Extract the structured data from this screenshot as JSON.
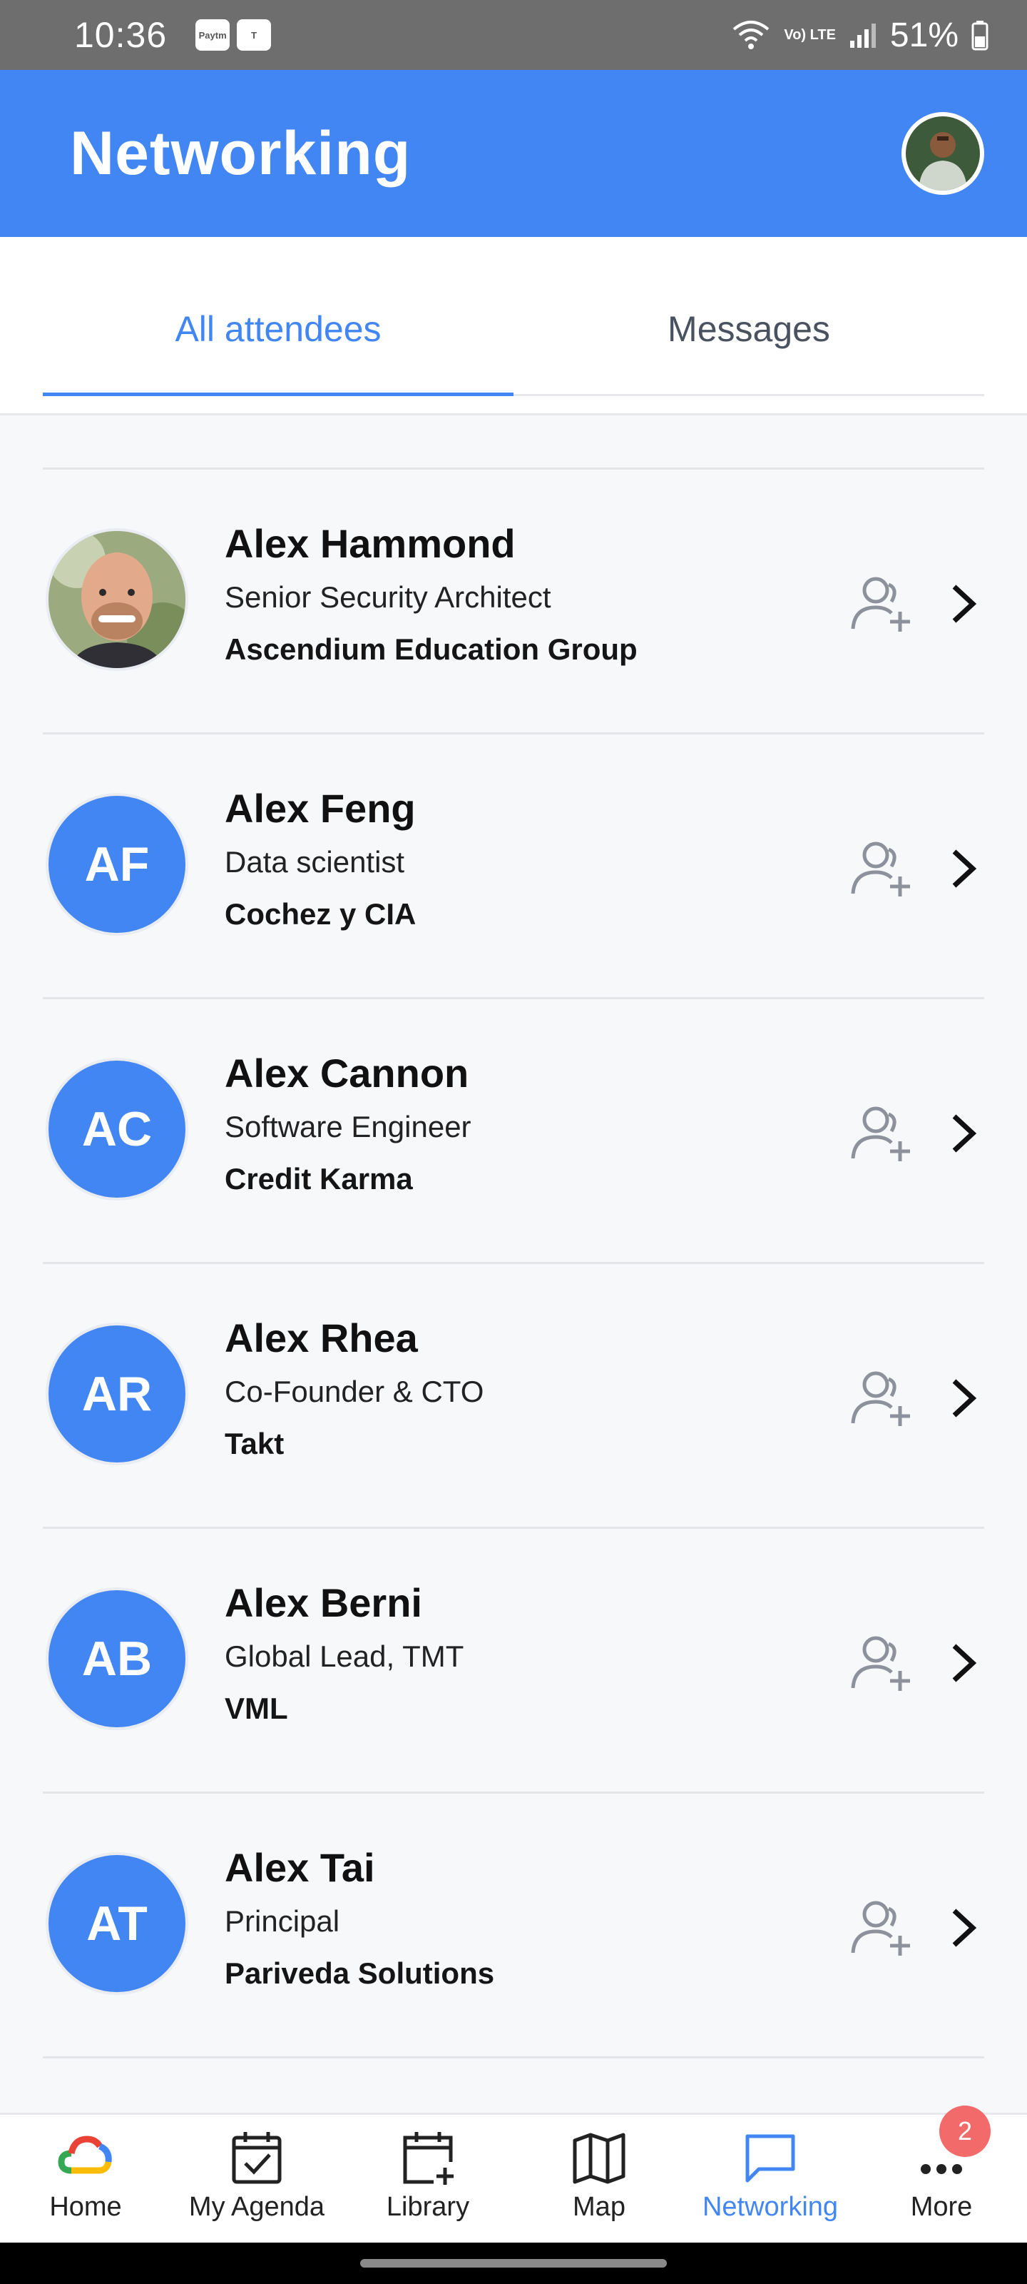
{
  "status_bar": {
    "time": "10:36",
    "apps": [
      "Paytm",
      "T"
    ],
    "lte": "Vo) LTE",
    "battery": "51%"
  },
  "header": {
    "title": "Networking"
  },
  "tabs": [
    {
      "label": "All attendees",
      "active": true
    },
    {
      "label": "Messages",
      "active": false
    }
  ],
  "attendees": [
    {
      "name": "Alex Hammond",
      "title": "Senior Security Architect",
      "company": "Ascendium Education Group",
      "initials": "",
      "photo": true
    },
    {
      "name": "Alex Feng",
      "title": "Data scientist",
      "company": "Cochez y CIA",
      "initials": "AF",
      "photo": false
    },
    {
      "name": "Alex Cannon",
      "title": "Software Engineer",
      "company": "Credit Karma",
      "initials": "AC",
      "photo": false
    },
    {
      "name": "Alex Rhea",
      "title": "Co-Founder & CTO",
      "company": "Takt",
      "initials": "AR",
      "photo": false
    },
    {
      "name": "Alex Berni",
      "title": "Global Lead, TMT",
      "company": "VML",
      "initials": "AB",
      "photo": false
    },
    {
      "name": "Alex Tai",
      "title": "Principal",
      "company": "Pariveda Solutions",
      "initials": "AT",
      "photo": false
    }
  ],
  "bottom_nav": {
    "items": [
      {
        "label": "Home",
        "icon": "google-cloud-icon"
      },
      {
        "label": "My Agenda",
        "icon": "calendar-check-icon"
      },
      {
        "label": "Library",
        "icon": "calendar-plus-icon"
      },
      {
        "label": "Map",
        "icon": "map-icon"
      },
      {
        "label": "Networking",
        "icon": "chat-icon",
        "active": true
      },
      {
        "label": "More",
        "icon": "more-icon"
      }
    ],
    "more_badge": "2"
  },
  "colors": {
    "primary": "#4286f4",
    "status_bar": "#6e6e6e",
    "badge": "#f26a6a"
  }
}
